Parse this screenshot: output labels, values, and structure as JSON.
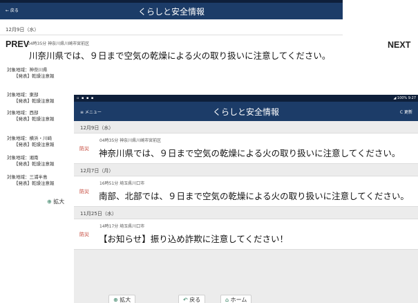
{
  "nav": {
    "prev": "PREV",
    "next": "NEXT"
  },
  "back_screen": {
    "back_label": "← 戻る",
    "title": "くらしと安全情報",
    "date": "12月9日（水）",
    "meta": "04時35分 神奈川県川崎市宮前区",
    "headline": "川奈川県では、９日まで空気の乾燥による火の取り扱いに注意してください。",
    "areas": [
      {
        "name": "対象地域：神奈川県",
        "status": "【発表】乾燥注意報"
      },
      {
        "name": "対象地域：東部",
        "status": "【発表】乾燥注意報"
      },
      {
        "name": "対象地域：西部",
        "status": "【発表】乾燥注意報"
      },
      {
        "name": "対象地域：横浜・川崎",
        "status": "【発表】乾燥注意報"
      },
      {
        "name": "対象地域：湘南",
        "status": "【発表】乾燥注意報"
      },
      {
        "name": "対象地域：三浦半島",
        "status": "【発表】乾燥注意報"
      }
    ],
    "zoom_label": "拡大"
  },
  "front_screen": {
    "status_right": "◢ 100% 9:27",
    "menu_label": "≡ メニュー",
    "title": "くらしと安全情報",
    "refresh_label": "C 更新",
    "groups": [
      {
        "date": "12月9日（水）",
        "tag": "防災",
        "meta": "04時35分 神奈川県川崎市宮前区",
        "message": "神奈川県では、９日まで空気の乾燥による火の取り扱いに注意してください。"
      },
      {
        "date": "12月7日（月）",
        "tag": "防災",
        "meta": "16時51分 埼玉県川口市",
        "message": "南部、北部では、９日まで空気の乾燥による火の取り扱いに注意してください。"
      },
      {
        "date": "11月25日（水）",
        "tag": "防災",
        "meta": "14時17分 埼玉県川口市",
        "message": "【お知らせ】振り込め詐欺に注意してください！"
      }
    ],
    "bottom": {
      "zoom": "拡大",
      "back": "戻る",
      "home": "ホーム"
    }
  }
}
